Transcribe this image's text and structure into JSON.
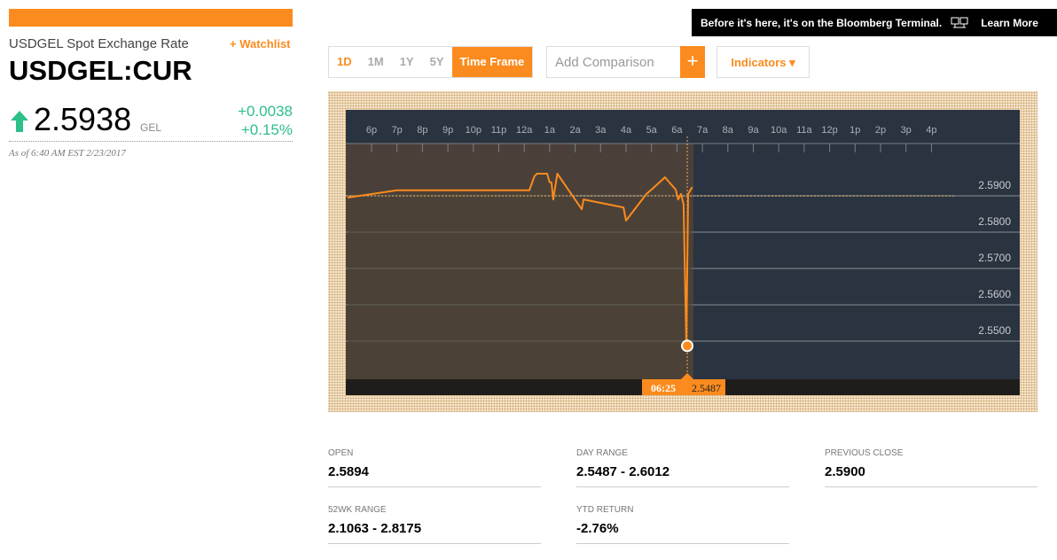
{
  "header": {
    "name": "USDGEL Spot Exchange Rate",
    "watchlist": "+ Watchlist",
    "ticker": "USDGEL:CUR",
    "price": "2.5938",
    "currency": "GEL",
    "change": "+0.0038",
    "change_pct": "+0.15%",
    "as_of": "As of 6:40 AM EST 2/23/2017"
  },
  "ad": {
    "text": "Before it's here, it's on the Bloomberg Terminal.",
    "link": "Learn More"
  },
  "controls": {
    "timeframes": [
      "1D",
      "1M",
      "1Y",
      "5Y"
    ],
    "time_frame": "Time Frame",
    "comparison_placeholder": "Add Comparison",
    "plus": "+",
    "indicators": "Indicators ▾"
  },
  "colors": {
    "accent": "#fb8b1e",
    "up": "#2cbf8a",
    "chart_bg": "#2a3340"
  },
  "chart_data": {
    "type": "line",
    "x_ticks": [
      "6p",
      "7p",
      "8p",
      "9p",
      "10p",
      "11p",
      "12a",
      "1a",
      "2a",
      "3a",
      "4a",
      "5a",
      "6a",
      "7a",
      "8a",
      "9a",
      "10a",
      "11a",
      "12p",
      "1p",
      "2p",
      "3p",
      "4p"
    ],
    "y_ticks": [
      "2.5900",
      "2.5800",
      "2.5700",
      "2.5600",
      "2.5500"
    ],
    "y_tick_values": [
      2.59,
      2.58,
      2.57,
      2.56,
      2.55
    ],
    "previous_close": 2.59,
    "x_unit": "hours since 6p",
    "points": [
      [
        -0.94,
        2.5895
      ],
      [
        1.0,
        2.5915
      ],
      [
        6.2,
        2.5915
      ],
      [
        6.4,
        2.5954
      ],
      [
        6.5,
        2.5961
      ],
      [
        6.9,
        2.5961
      ],
      [
        7.0,
        2.5937
      ],
      [
        7.07,
        2.5937
      ],
      [
        7.14,
        2.589
      ],
      [
        7.3,
        2.5961
      ],
      [
        8.26,
        2.5863
      ],
      [
        8.33,
        2.589
      ],
      [
        9.9,
        2.5868
      ],
      [
        10.0,
        2.5832
      ],
      [
        10.8,
        2.5905
      ],
      [
        11.0,
        2.5917
      ],
      [
        11.53,
        2.5951
      ],
      [
        11.95,
        2.5917
      ],
      [
        12.05,
        2.589
      ],
      [
        12.16,
        2.5905
      ],
      [
        12.26,
        2.5876
      ],
      [
        12.37,
        2.5487
      ],
      [
        12.44,
        2.5905
      ],
      [
        12.6,
        2.5924
      ]
    ],
    "cursor": {
      "time": "06:25",
      "value": "2.5487",
      "x": 12.37,
      "y": 2.5487
    }
  },
  "stats": [
    {
      "label": "OPEN",
      "value": "2.5894"
    },
    {
      "label": "DAY RANGE",
      "value": "2.5487 - 2.6012"
    },
    {
      "label": "PREVIOUS CLOSE",
      "value": "2.5900"
    },
    {
      "label": "52WK RANGE",
      "value": "2.1063 - 2.8175"
    },
    {
      "label": "YTD RETURN",
      "value": "-2.76%"
    }
  ]
}
